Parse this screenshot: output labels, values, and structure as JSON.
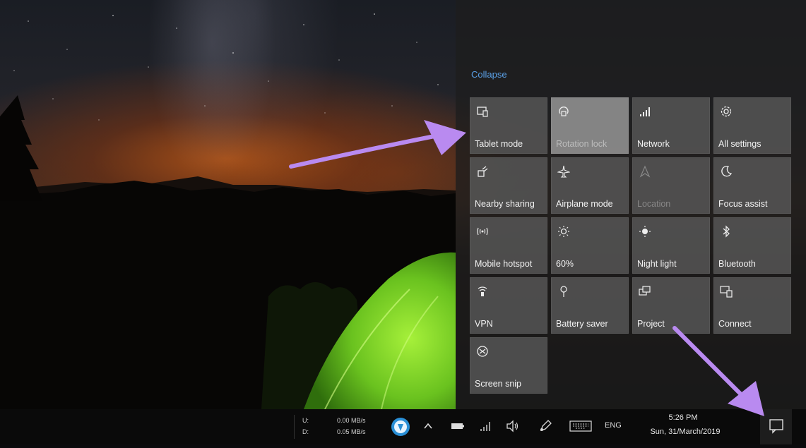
{
  "action_center": {
    "collapse_label": "Collapse",
    "tiles": [
      {
        "label": "Tablet mode",
        "icon": "tablet-mode-icon",
        "state": "normal"
      },
      {
        "label": "Rotation lock",
        "icon": "rotation-lock-icon",
        "state": "active"
      },
      {
        "label": "Network",
        "icon": "network-icon",
        "state": "normal"
      },
      {
        "label": "All settings",
        "icon": "gear-icon",
        "state": "normal"
      },
      {
        "label": "Nearby sharing",
        "icon": "nearby-sharing-icon",
        "state": "normal"
      },
      {
        "label": "Airplane mode",
        "icon": "airplane-icon",
        "state": "normal"
      },
      {
        "label": "Location",
        "icon": "location-icon",
        "state": "disabled"
      },
      {
        "label": "Focus assist",
        "icon": "moon-icon",
        "state": "normal"
      },
      {
        "label": "Mobile hotspot",
        "icon": "mobile-hotspot-icon",
        "state": "normal"
      },
      {
        "label": "60%",
        "icon": "brightness-icon",
        "state": "normal"
      },
      {
        "label": "Night light",
        "icon": "night-light-icon",
        "state": "normal"
      },
      {
        "label": "Bluetooth",
        "icon": "bluetooth-icon",
        "state": "normal"
      },
      {
        "label": "VPN",
        "icon": "vpn-icon",
        "state": "normal"
      },
      {
        "label": "Battery saver",
        "icon": "battery-saver-icon",
        "state": "normal"
      },
      {
        "label": "Project",
        "icon": "project-icon",
        "state": "normal"
      },
      {
        "label": "Connect",
        "icon": "connect-icon",
        "state": "normal"
      },
      {
        "label": "Screen snip",
        "icon": "screen-snip-icon",
        "state": "normal"
      }
    ]
  },
  "taskbar": {
    "net_up_label": "U:",
    "net_down_label": "D:",
    "net_up_speed": "0.00 MB/s",
    "net_down_speed": "0.05 MB/s",
    "clock_time": "5:26 PM",
    "clock_date": "Sun, 31/March/2019",
    "language": "ENG",
    "tray_icons": [
      "app-icon",
      "chevron-up-icon",
      "battery-icon",
      "wifi-icon",
      "volume-icon",
      "pen-icon",
      "keyboard-icon"
    ]
  },
  "colors": {
    "accent_link": "#5aa0e6",
    "arrow": "#b98af0",
    "tent": "#7fd22a"
  }
}
